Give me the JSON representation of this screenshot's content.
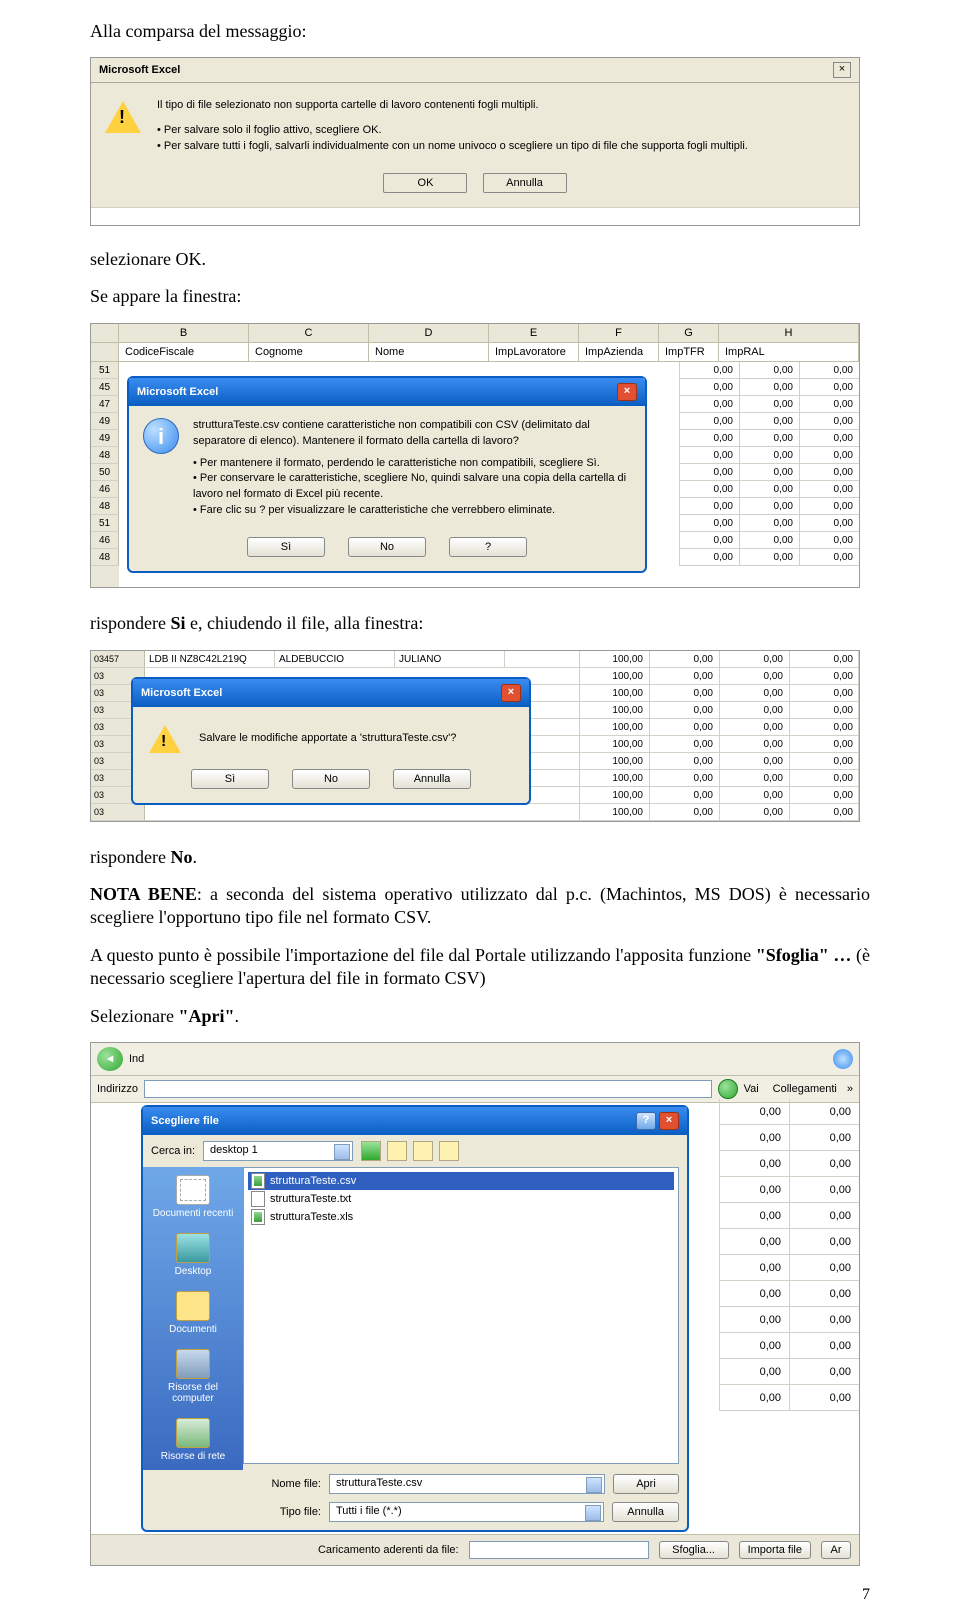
{
  "text": {
    "intro": "Alla comparsa del messaggio:",
    "sel_ok": "selezionare OK.",
    "se_appare": "Se appare la finestra:",
    "risp_si": "rispondere Si e, chiudendo il file, alla finestra:",
    "risp_no": "rispondere No.",
    "nota_bene_lead": "NOTA BENE",
    "nota_bene_body": ": a seconda del sistema operativo utilizzato dal p.c. (Machintos, MS DOS) è necessario scegliere l'opportuno tipo file nel formato CSV.",
    "a_questo_1": "A questo punto è possibile l'importazione del file dal Portale utilizzando l'apposita funzione ",
    "a_questo_sfoglia": "\"Sfoglia\" …",
    "a_questo_2": " (è necessario scegliere l'apertura del file in formato CSV)",
    "sel_apri_1": "Selezionare ",
    "sel_apri_2": "\"Apri\"",
    "sel_apri_3": "."
  },
  "dlg1": {
    "title": "Microsoft Excel",
    "line1": "Il tipo di file selezionato non supporta cartelle di lavoro contenenti fogli multipli.",
    "bullet1": "• Per salvare solo il foglio attivo, scegliere OK.",
    "bullet2": "• Per salvare tutti i fogli, salvarli individualmente con un nome univoco o scegliere un tipo di file che supporta fogli multipli.",
    "btn_ok": "OK",
    "btn_cancel": "Annulla"
  },
  "dlg2": {
    "title": "Microsoft Excel",
    "cols": [
      "B",
      "C",
      "D",
      "E",
      "F",
      "G",
      "H"
    ],
    "colnames": [
      "CodiceFiscale",
      "Cognome",
      "Nome",
      "ImpLavoratore",
      "ImpAzienda",
      "ImpTFR",
      "ImpRAL"
    ],
    "rownums": [
      "51",
      "45",
      "47",
      "49",
      "49",
      "48",
      "50",
      "46",
      "48",
      "51",
      "46",
      "48"
    ],
    "line1": "strutturaTeste.csv contiene caratteristiche non compatibili con CSV (delimitato dal separatore di elenco). Mantenere il formato della cartella di lavoro?",
    "bul1": "• Per mantenere il formato, perdendo le caratteristiche non compatibili, scegliere Sì.",
    "bul2": "• Per conservare le caratteristiche, scegliere No, quindi salvare una copia della cartella di lavoro nel formato di Excel più recente.",
    "bul3": "• Fare clic su ? per visualizzare le caratteristiche che verrebbero eliminate.",
    "btn_yes": "Sì",
    "btn_no": "No",
    "btn_q": "?",
    "zero": "0,00"
  },
  "dlg3": {
    "title": "Microsoft Excel",
    "msg": "Salvare le modifiche apportate a 'strutturaTeste.csv'?",
    "btn_yes": "Sì",
    "btn_no": "No",
    "btn_cancel": "Annulla",
    "val100": "100,00",
    "val0": "0,00",
    "row_code_sample": "LDB II NZ8C42L219Q",
    "row_last": "ALDEBUCCIO",
    "row_first": "JULIANO"
  },
  "dlg4": {
    "title": "Scegliere file",
    "back_label": "Ind",
    "addr_label": "Indirizzo",
    "go_label": "Vai",
    "links_label": "Collegamenti",
    "search_in": "Cerca in:",
    "folder": "desktop 1",
    "files": [
      "strutturaTeste.csv",
      "strutturaTeste.txt",
      "strutturaTeste.xls"
    ],
    "side": [
      "Documenti recenti",
      "Desktop",
      "Documenti",
      "Risorse del computer",
      "Risorse di rete"
    ],
    "filename_lbl": "Nome file:",
    "filename_val": "strutturaTeste.csv",
    "filetype_lbl": "Tipo file:",
    "filetype_val": "Tutti i file (*.*)",
    "btn_open": "Apri",
    "btn_cancel": "Annulla",
    "right_zero": "0,00",
    "load_label": "Caricamento aderenti da file:",
    "btn_sfoglia": "Sfoglia...",
    "btn_import": "Importa file",
    "btn_ar": "Ar"
  },
  "page": "7"
}
